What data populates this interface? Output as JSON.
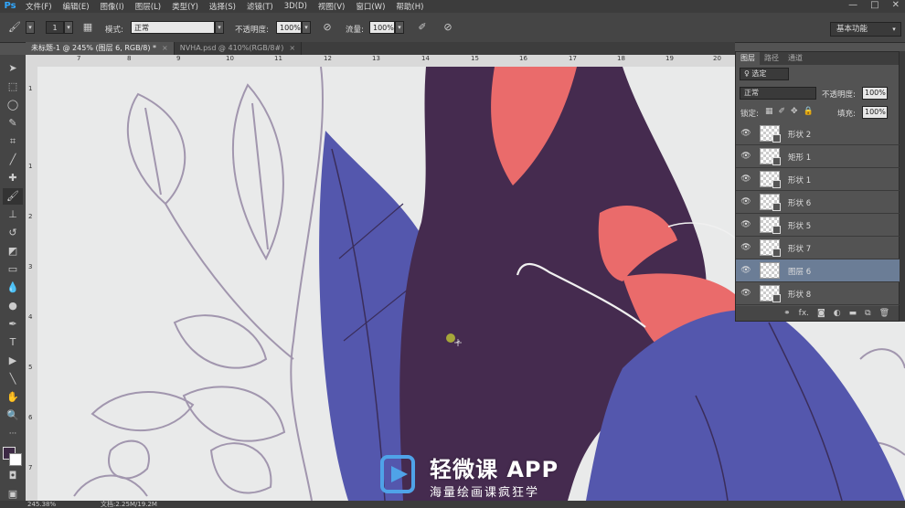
{
  "app": {
    "logo": "Ps"
  },
  "menu": [
    "文件(F)",
    "编辑(E)",
    "图像(I)",
    "图层(L)",
    "类型(Y)",
    "选择(S)",
    "滤镜(T)",
    "3D(D)",
    "视图(V)",
    "窗口(W)",
    "帮助(H)"
  ],
  "window_controls": {
    "minimize": "—",
    "restore": "□",
    "close": "✕"
  },
  "options": {
    "brush_size": "1",
    "mode_label": "模式:",
    "mode_value": "正常",
    "opacity_label": "不透明度:",
    "opacity_value": "100%",
    "flow_label": "流量:",
    "flow_value": "100%"
  },
  "workspace": "基本功能",
  "tabs": [
    {
      "label": "未标题-1 @ 245% (图层 6, RGB/8) *",
      "close": "×"
    },
    {
      "label": "NVHA.psd @ 410%(RGB/8#)",
      "close": "×"
    }
  ],
  "ruler_top": [
    "7",
    "8",
    "9",
    "10",
    "11",
    "12",
    "13",
    "14",
    "15",
    "16",
    "17",
    "18",
    "19",
    "20"
  ],
  "ruler_left": [
    "1",
    "1",
    "2",
    "3",
    "4",
    "5",
    "6",
    "7"
  ],
  "status": {
    "zoom": "245.38%",
    "doc": "文档:2.25M/19.2M"
  },
  "layers_panel": {
    "tabs": [
      "图层",
      "路径",
      "通道"
    ],
    "filter_placeholder": "♀ 选定",
    "blend_mode": "正常",
    "opacity_label": "不透明度:",
    "opacity_value": "100%",
    "lock_label": "锁定:",
    "fill_label": "填充:",
    "fill_value": "100%",
    "layers": [
      {
        "name": "形状 2",
        "selected": false
      },
      {
        "name": "矩形 1",
        "selected": false
      },
      {
        "name": "形状 1",
        "selected": false
      },
      {
        "name": "形状 6",
        "selected": false
      },
      {
        "name": "形状 5",
        "selected": false
      },
      {
        "name": "形状 7",
        "selected": false
      },
      {
        "name": "图层 6",
        "selected": true
      },
      {
        "name": "形状 8",
        "selected": false
      }
    ],
    "footer_icons": [
      "link-icon",
      "fx-icon",
      "mask-icon",
      "adjustment-icon",
      "folder-icon",
      "new-layer-icon",
      "trash-icon"
    ]
  },
  "watermark": {
    "title": "轻微课 APP",
    "subtitle": "海量绘画课疯狂学"
  },
  "colors": {
    "dark_purple": "#452b4f",
    "coral": "#ea6b6b",
    "blue": "#5457ad",
    "canvas_bg": "#e9eaea",
    "fg": "#3d2a45"
  }
}
